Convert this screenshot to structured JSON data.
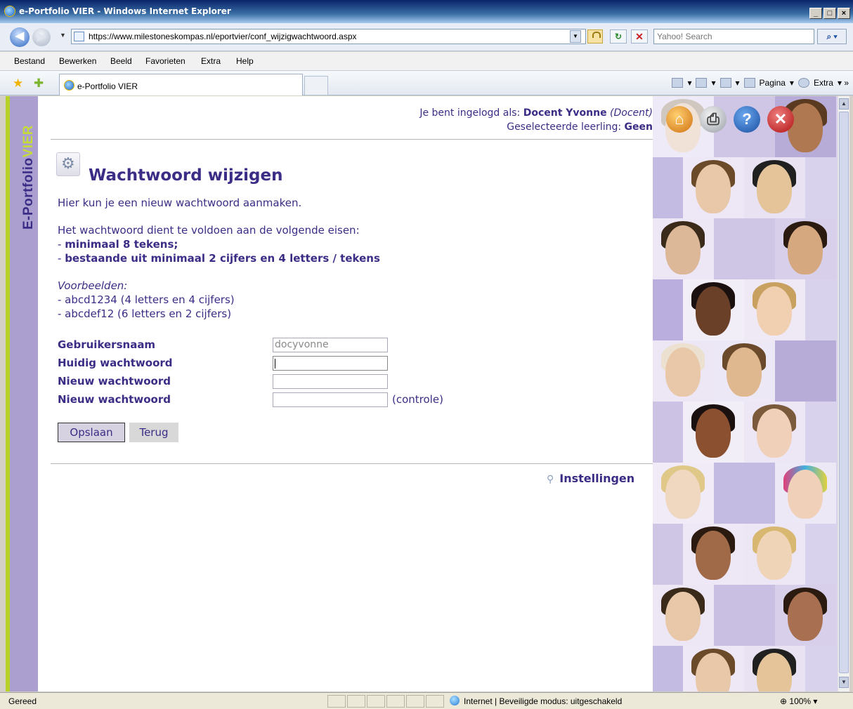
{
  "browser": {
    "window_title": "e-Portfolio VIER - Windows Internet Explorer",
    "url": "https://www.milestoneskompas.nl/eportvier/conf_wijzigwachtwoord.aspx",
    "search_placeholder": "Yahoo! Search",
    "menu": [
      "Bestand",
      "Bewerken",
      "Beeld",
      "Favorieten",
      "Extra",
      "Help"
    ],
    "tab_title": "e-Portfolio VIER",
    "cmd": {
      "page": "Pagina",
      "extra": "Extra"
    },
    "status": "Gereed",
    "zone": "Internet | Beveiligde modus: uitgeschakeld",
    "zoom": "100%"
  },
  "logo": {
    "prefix": "E-Portfolio",
    "suffix": "VIER"
  },
  "user": {
    "logged_in_label": "Je bent ingelogd als:",
    "name": "Docent Yvonne",
    "role": "(Docent)",
    "student_label": "Geselecteerde leerling:",
    "student": "Geen"
  },
  "page": {
    "title": "Wachtwoord wijzigen",
    "intro": "Hier kun je een nieuw wachtwoord aanmaken.",
    "requirements_intro": "Het wachtwoord dient te voldoen aan de volgende eisen:",
    "requirements": [
      "minimaal 8 tekens;",
      "bestaande uit minimaal 2 cijfers en 4 letters / tekens"
    ],
    "examples_heading": "Voorbeelden:",
    "examples": [
      "- abcd1234 (4 letters en 4 cijfers)",
      "- abcdef12 (6 letters en 2 cijfers)"
    ]
  },
  "form": {
    "username_label": "Gebruikersnaam",
    "username_value": "docyvonne",
    "current_label": "Huidig wachtwoord",
    "new_label": "Nieuw wachtwoord",
    "confirm_label": "Nieuw wachtwoord",
    "confirm_suffix": "(controle)",
    "save": "Opslaan",
    "back": "Terug"
  },
  "settings_link": "Instellingen",
  "colors": {
    "brand_purple": "#3b2d86",
    "sidebar": "#aa9fcf",
    "accent_green": "#b8d12a"
  }
}
